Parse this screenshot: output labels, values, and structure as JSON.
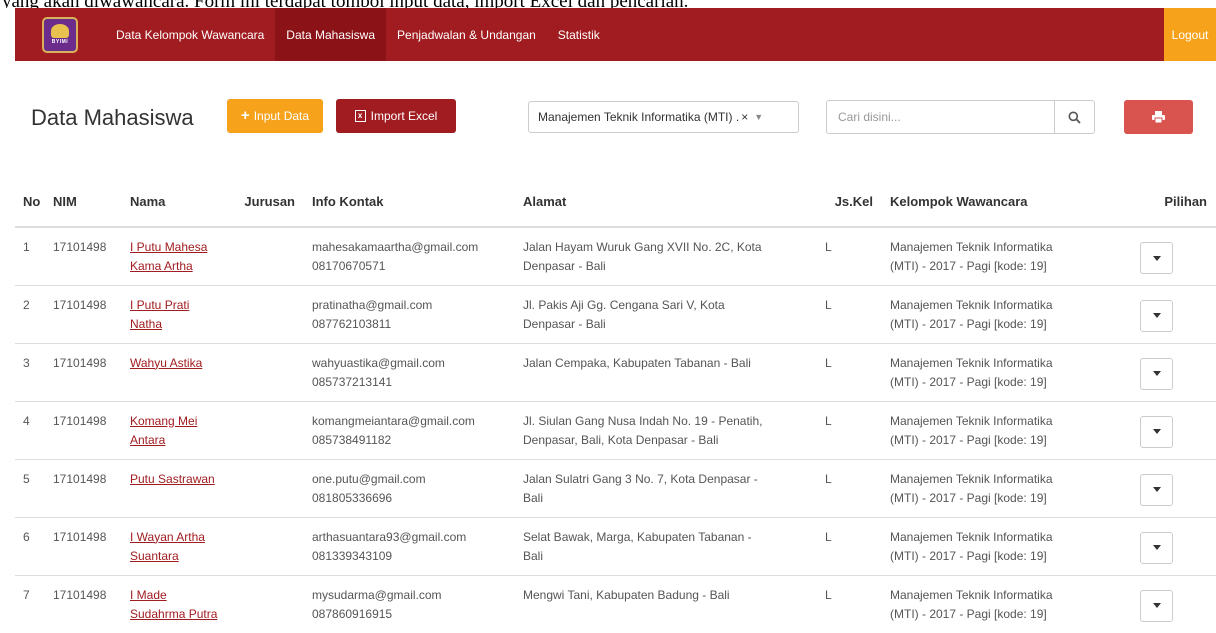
{
  "caption": "yang akan diwawancara. Form ini terdapat tombol input data, import Excel dan pencarian.",
  "nav": {
    "logo_text": "BYIMI",
    "items": [
      {
        "label": "Data Kelompok Wawancara"
      },
      {
        "label": "Data Mahasiswa"
      },
      {
        "label": "Penjadwalan & Undangan"
      },
      {
        "label": "Statistik"
      }
    ],
    "logout": "Logout"
  },
  "toolbar": {
    "title": "Data Mahasiswa",
    "input_label": "Input Data",
    "import_label": "Import Excel",
    "select_value": "Manajemen Teknik Informatika (MTI) .",
    "select_clear": "×",
    "search_placeholder": "Cari disini..."
  },
  "table": {
    "headers": {
      "no": "No",
      "nim": "NIM",
      "nama": "Nama",
      "jurusan": "Jurusan",
      "kontak": "Info Kontak",
      "alamat": "Alamat",
      "jk": "Js.Kel",
      "kelompok": "Kelompok Wawancara",
      "pilihan": "Pilihan"
    },
    "rows": [
      {
        "no": "1",
        "nim": "17101498",
        "nama1": "I Putu Mahesa",
        "nama2": "Kama Artha",
        "jurusan": "",
        "email": "mahesakamaartha@gmail.com",
        "phone": "08170670571",
        "alamat1": "Jalan Hayam Wuruk Gang XVII No. 2C, Kota",
        "alamat2": "Denpasar - Bali",
        "jk": "L",
        "kel1": "Manajemen Teknik Informatika",
        "kel2": "(MTI) - 2017 - Pagi [kode: 19]"
      },
      {
        "no": "2",
        "nim": "17101498",
        "nama1": "I Putu Prati",
        "nama2": "Natha",
        "jurusan": "",
        "email": "pratinatha@gmail.com",
        "phone": "087762103811",
        "alamat1": "Jl. Pakis Aji Gg. Cengana Sari V, Kota",
        "alamat2": "Denpasar - Bali",
        "jk": "L",
        "kel1": "Manajemen Teknik Informatika",
        "kel2": "(MTI) - 2017 - Pagi [kode: 19]"
      },
      {
        "no": "3",
        "nim": "17101498",
        "nama1": "Wahyu Astika",
        "nama2": "",
        "jurusan": "",
        "email": "wahyuastika@gmail.com",
        "phone": "085737213141",
        "alamat1": "Jalan Cempaka, Kabupaten Tabanan - Bali",
        "alamat2": "",
        "jk": "L",
        "kel1": "Manajemen Teknik Informatika",
        "kel2": "(MTI) - 2017 - Pagi [kode: 19]"
      },
      {
        "no": "4",
        "nim": "17101498",
        "nama1": "Komang Mei",
        "nama2": "Antara",
        "jurusan": "",
        "email": "komangmeiantara@gmail.com",
        "phone": "085738491182",
        "alamat1": "Jl. Siulan Gang Nusa Indah No. 19 - Penatih,",
        "alamat2": "Denpasar, Bali, Kota Denpasar - Bali",
        "jk": "L",
        "kel1": "Manajemen Teknik Informatika",
        "kel2": "(MTI) - 2017 - Pagi [kode: 19]"
      },
      {
        "no": "5",
        "nim": "17101498",
        "nama1": "Putu Sastrawan",
        "nama2": "",
        "jurusan": "",
        "email": "one.putu@gmail.com",
        "phone": "081805336696",
        "alamat1": "Jalan Sulatri Gang 3 No. 7, Kota Denpasar -",
        "alamat2": "Bali",
        "jk": "L",
        "kel1": "Manajemen Teknik Informatika",
        "kel2": "(MTI) - 2017 - Pagi [kode: 19]"
      },
      {
        "no": "6",
        "nim": "17101498",
        "nama1": "I Wayan Artha",
        "nama2": "Suantara",
        "jurusan": "",
        "email": "arthasuantara93@gmail.com",
        "phone": "081339343109",
        "alamat1": "Selat Bawak, Marga, Kabupaten Tabanan -",
        "alamat2": "Bali",
        "jk": "L",
        "kel1": "Manajemen Teknik Informatika",
        "kel2": "(MTI) - 2017 - Pagi [kode: 19]"
      },
      {
        "no": "7",
        "nim": "17101498",
        "nama1": "I Made",
        "nama2": "Sudahrma Putra",
        "jurusan": "",
        "email": "mysudarma@gmail.com",
        "phone": "087860916915",
        "alamat1": "Mengwi Tani, Kabupaten Badung - Bali",
        "alamat2": "",
        "jk": "L",
        "kel1": "Manajemen Teknik Informatika",
        "kel2": "(MTI) - 2017 - Pagi [kode: 19]"
      }
    ]
  },
  "icons": {
    "plus": "plus-icon",
    "excel": "excel-icon",
    "search": "search-icon",
    "print": "print-icon",
    "caret": "caret-down-icon"
  },
  "colors": {
    "navbar": "#a01c20",
    "nav_active": "#8b1216",
    "accent_orange": "#f7a21b",
    "print_red": "#d9534f",
    "link": "#a01c20"
  }
}
